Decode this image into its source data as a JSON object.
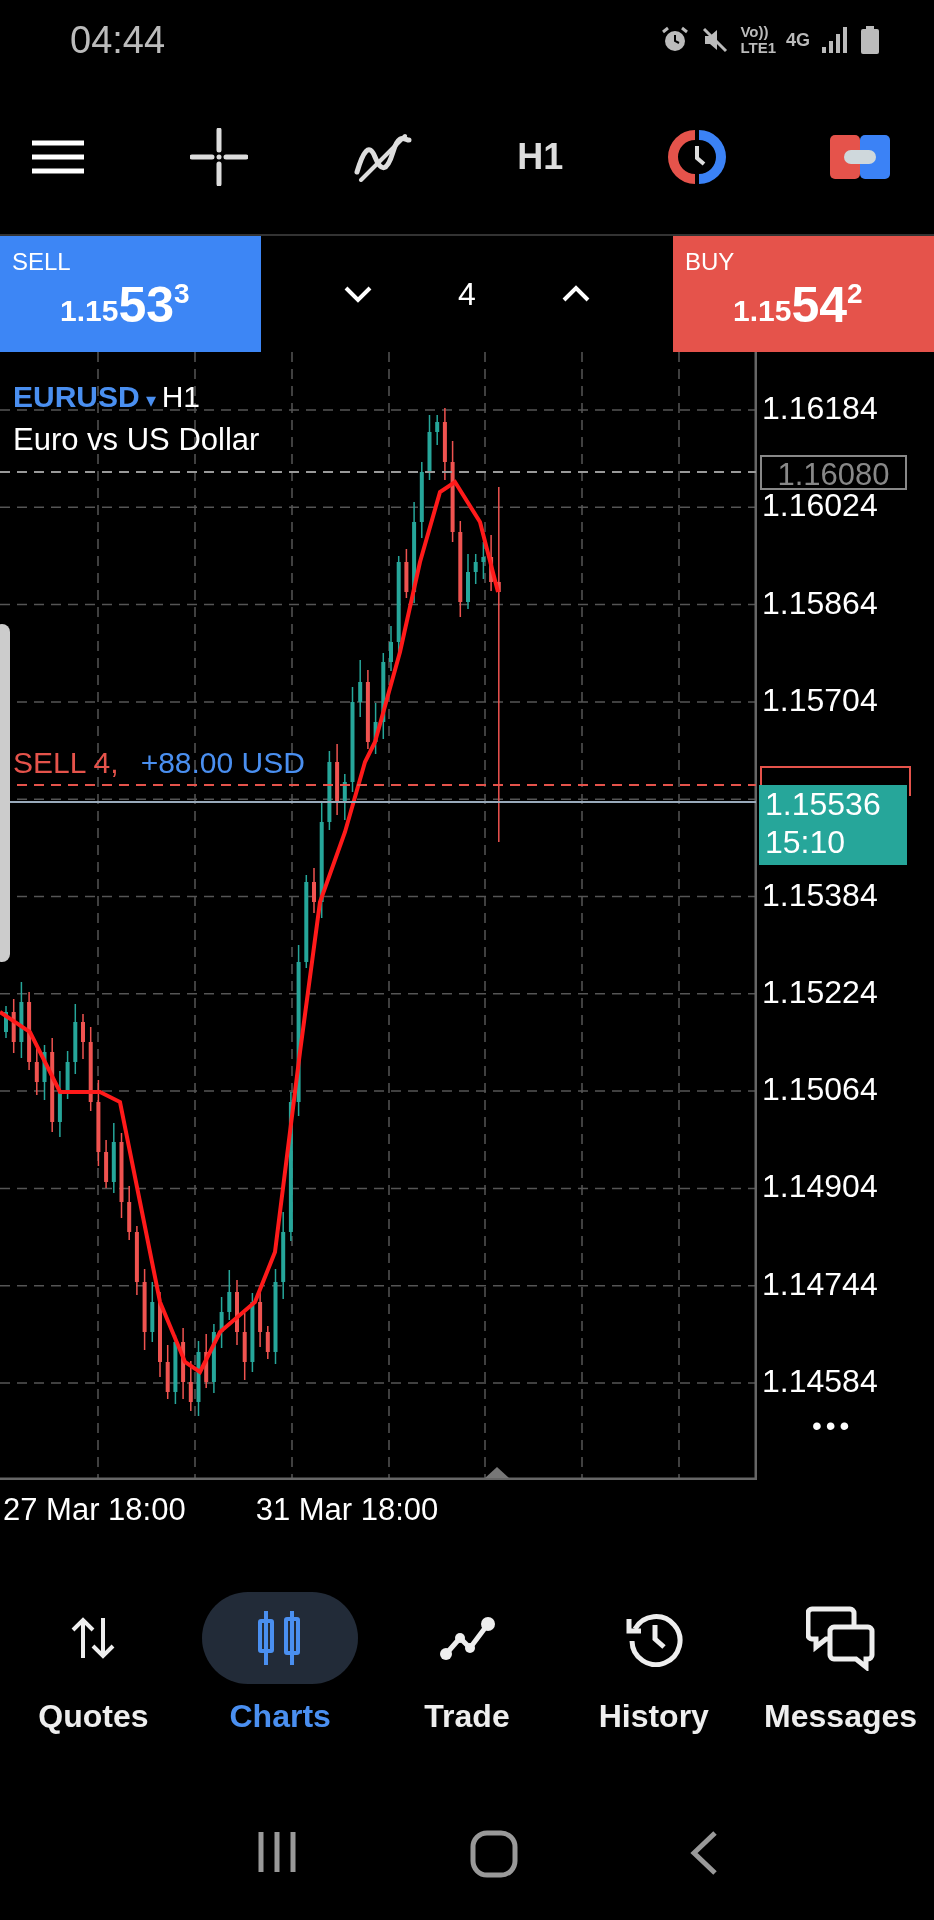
{
  "status_bar": {
    "time": "04:44",
    "volte": "Vo))",
    "lte": "LTE1",
    "network": "4G"
  },
  "toolbar": {
    "timeframe": "H1"
  },
  "trade_panel": {
    "sell": {
      "label": "SELL",
      "price_prefix": "1.15",
      "price_big": "53",
      "price_sup": "3"
    },
    "volume": "4",
    "buy": {
      "label": "BUY",
      "price_prefix": "1.15",
      "price_big": "54",
      "price_sup": "2"
    }
  },
  "chart": {
    "symbol": "EURUSD",
    "dropdown_glyph": "▾",
    "timeframe": "H1",
    "description": "Euro vs US Dollar",
    "price_labels": [
      "1.16184",
      "1.16024",
      "1.15864",
      "1.15704",
      "1.15384",
      "1.15224",
      "1.15064",
      "1.14904",
      "1.14744",
      "1.14584"
    ],
    "stop_loss_price": "1.16080",
    "position": {
      "side": "SELL 4,",
      "profit": "+88.00 USD"
    },
    "current_price": "1.15536",
    "countdown": "15:10",
    "more_glyph": "•••",
    "time_labels": [
      "27 Mar 18:00",
      "31 Mar 18:00"
    ]
  },
  "nav": [
    {
      "kind": "quotes",
      "label": "Quotes",
      "selected": false
    },
    {
      "kind": "charts",
      "label": "Charts",
      "selected": true
    },
    {
      "kind": "trade",
      "label": "Trade",
      "selected": false
    },
    {
      "kind": "history",
      "label": "History",
      "selected": false
    },
    {
      "kind": "messages",
      "label": "Messages",
      "selected": false
    }
  ]
}
